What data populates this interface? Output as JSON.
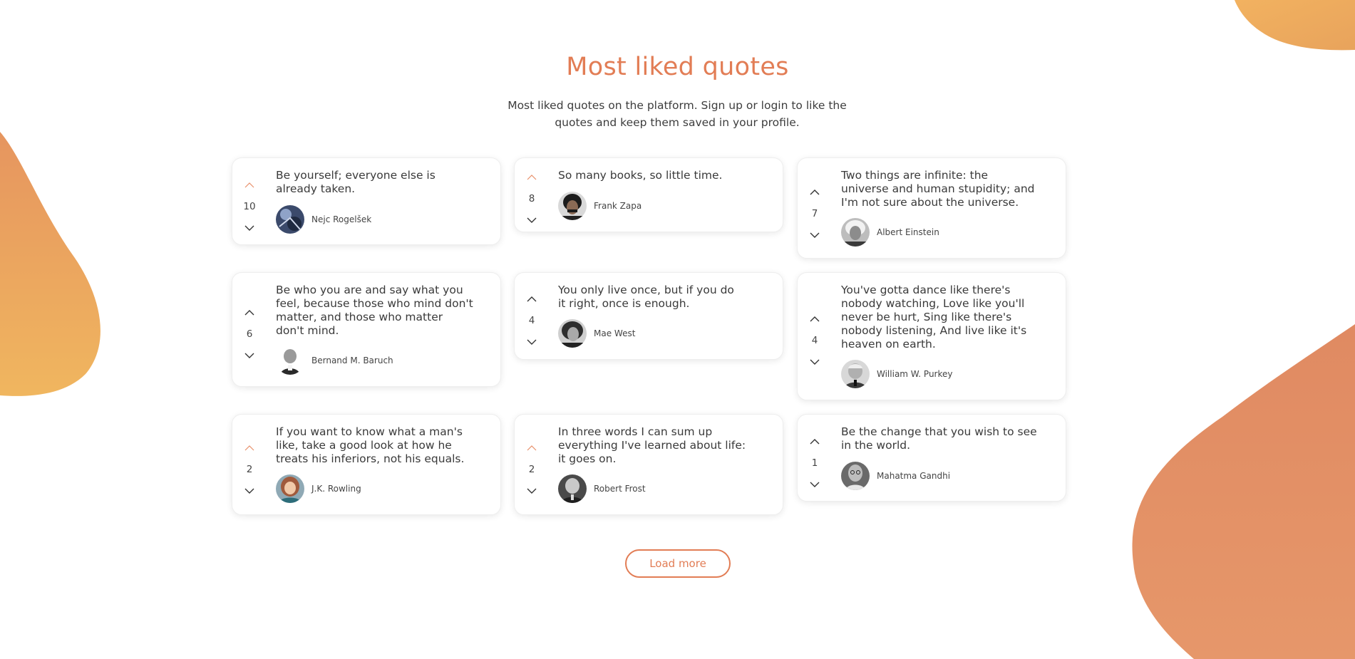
{
  "colors": {
    "accent": "#e27d55",
    "vote_active": "#e8906a",
    "text": "#3a3a3a",
    "blob_light": "#f0b35f",
    "blob_dark": "#e08060"
  },
  "header": {
    "title": "Most liked quotes",
    "subtitle": "Most liked quotes on the platform. Sign up or login to like the quotes and keep them saved in your profile."
  },
  "quotes": [
    {
      "text": "Be yourself; everyone else is already taken.",
      "author": "Nejc Rogelšek",
      "votes": "10",
      "upvoted": true
    },
    {
      "text": "So many books, so little time.",
      "author": "Frank Zapa",
      "votes": "8",
      "upvoted": true
    },
    {
      "text": "Two things are infinite: the universe and human stupidity; and I'm not sure about the universe.",
      "author": "Albert Einstein",
      "votes": "7",
      "upvoted": false
    },
    {
      "text": "Be who you are and say what you feel, because those who mind don't matter, and those who matter don't mind.",
      "author": "Bernand M. Baruch",
      "votes": "6",
      "upvoted": false
    },
    {
      "text": "You only live once, but if you do it right, once is enough.",
      "author": "Mae West",
      "votes": "4",
      "upvoted": false
    },
    {
      "text": "You've gotta dance like there's nobody watching, Love like you'll never be hurt, Sing like there's nobody listening, And live like it's heaven on earth.",
      "author": "William W. Purkey",
      "votes": "4",
      "upvoted": false
    },
    {
      "text": "If you want to know what a man's like, take a good look at how he treats his inferiors, not his equals.",
      "author": "J.K. Rowling",
      "votes": "2",
      "upvoted": true
    },
    {
      "text": "In three words I can sum up everything I've learned about life: it goes on.",
      "author": "Robert Frost",
      "votes": "2",
      "upvoted": true
    },
    {
      "text": "Be the change that you wish to see in the world.",
      "author": "Mahatma Gandhi",
      "votes": "1",
      "upvoted": false
    }
  ],
  "load_more_label": "Load more"
}
